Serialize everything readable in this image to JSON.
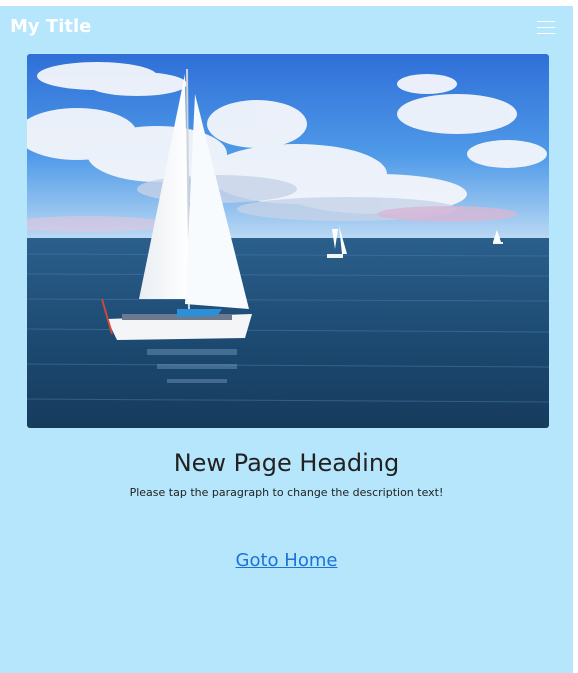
{
  "navbar": {
    "title": "My Title",
    "menu_icon": "hamburger-icon"
  },
  "hero": {
    "image_subject": "sailboat-on-ocean"
  },
  "main": {
    "heading": "New Page Heading",
    "description": "Please tap the paragraph to change the description text!",
    "home_link": "Goto Home"
  },
  "colors": {
    "page_background": "#b5e6fb",
    "link": "#1a73d9",
    "heading": "#222222"
  }
}
